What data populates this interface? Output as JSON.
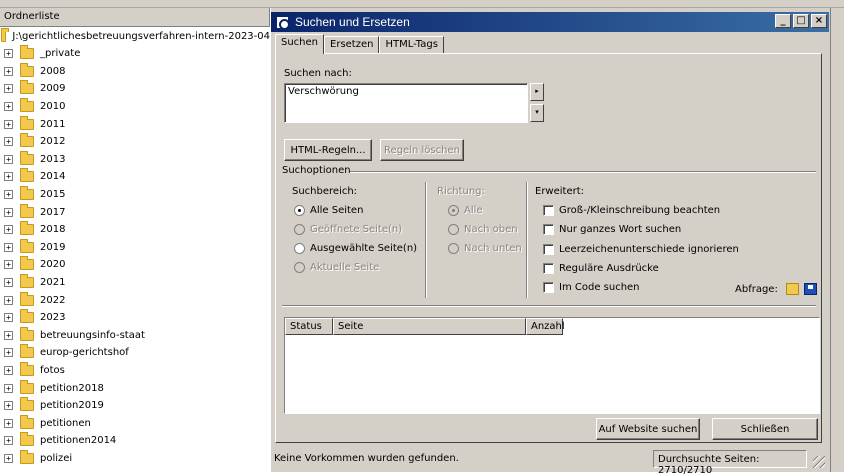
{
  "tree": {
    "header": "Ordnerliste",
    "root": "J:\\gerichtlichesbetreuungsverfahren-intern-2023-04",
    "items": [
      "_private",
      "2008",
      "2009",
      "2010",
      "2011",
      "2012",
      "2013",
      "2014",
      "2015",
      "2017",
      "2018",
      "2019",
      "2020",
      "2021",
      "2022",
      "2023",
      "betreuungsinfo-staat",
      "europ-gerichtshof",
      "fotos",
      "petition2018",
      "petition2019",
      "petitionen",
      "petitionen2014",
      "polizei"
    ]
  },
  "dialog": {
    "title": "Suchen und Ersetzen",
    "window_buttons": {
      "minimize": "_",
      "maximize": "□",
      "close": "×"
    },
    "tabs": [
      "Suchen",
      "Ersetzen",
      "HTML-Tags"
    ],
    "search_label": "Suchen nach:",
    "search_value": "Verschwörung",
    "spin_up": "▸",
    "spin_down": "▾",
    "html_rules_button": "HTML-Regeln...",
    "clear_rules_button": "Regeln löschen",
    "search_options_label": "Suchoptionen",
    "scope": {
      "label": "Suchbereich:",
      "options": [
        {
          "label": "Alle Seiten",
          "checked": true,
          "enabled": true
        },
        {
          "label": "Geöffnete Seite(n)",
          "checked": false,
          "enabled": false
        },
        {
          "label": "Ausgewählte Seite(n)",
          "checked": false,
          "enabled": true
        },
        {
          "label": "Aktuelle Seite",
          "checked": false,
          "enabled": false
        }
      ]
    },
    "direction": {
      "label": "Richtung:",
      "options": [
        {
          "label": "Alle",
          "checked": true
        },
        {
          "label": "Nach oben",
          "checked": false
        },
        {
          "label": "Nach unten",
          "checked": false
        }
      ]
    },
    "advanced": {
      "label": "Erweitert:",
      "options": [
        "Groß-/Kleinschreibung beachten",
        "Nur ganzes Wort suchen",
        "Leerzeichenunterschiede ignorieren",
        "Reguläre Ausdrücke",
        "Im Code suchen"
      ]
    },
    "query_label": "Abfrage:",
    "results_columns": [
      "Status",
      "Seite",
      "Anzahl"
    ],
    "search_site_button": "Auf Website suchen",
    "close_button": "Schließen",
    "status_message": "Keine Vorkommen wurden gefunden.",
    "pages_searched": "Durchsuchte Seiten: 2710/2710"
  },
  "colors": {
    "titlebar_start": "#0a246a",
    "titlebar_end": "#3a6ea5",
    "face": "#d4d0c8"
  }
}
